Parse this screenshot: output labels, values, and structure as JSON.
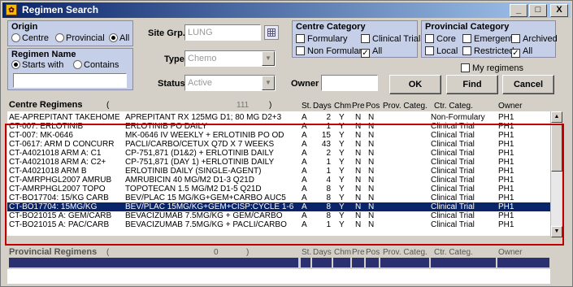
{
  "window": {
    "title": "Regimen Search",
    "app_icon": "app-icon",
    "minimize": "_",
    "maximize": "□",
    "close": "X"
  },
  "origin": {
    "title": "Origin",
    "options": [
      "Centre",
      "Provincial",
      "All"
    ],
    "selected": "All"
  },
  "regimen_name": {
    "title": "Regimen Name",
    "options": [
      "Starts with",
      "Contains"
    ],
    "selected": "Starts with",
    "value": ""
  },
  "site_group": {
    "label": "Site Grp.",
    "value": "LUNG"
  },
  "type": {
    "label": "Type",
    "value": "Chemo"
  },
  "status": {
    "label": "Status",
    "value": "Active"
  },
  "owner": {
    "label": "Owner",
    "value": ""
  },
  "centre_category": {
    "title": "Centre Category",
    "items": [
      {
        "label": "Formulary",
        "checked": false
      },
      {
        "label": "Clinical Trial",
        "checked": false
      },
      {
        "label": "Non Formulary",
        "checked": false
      },
      {
        "label": "All",
        "checked": true
      }
    ]
  },
  "provincial_category": {
    "title": "Provincial Category",
    "items": [
      {
        "label": "Core",
        "checked": false
      },
      {
        "label": "Emergent",
        "checked": false
      },
      {
        "label": "Archived",
        "checked": false
      },
      {
        "label": "Local",
        "checked": false
      },
      {
        "label": "Restricted",
        "checked": false
      },
      {
        "label": "All",
        "checked": true
      }
    ]
  },
  "my_regimens": {
    "label": "My regimens",
    "checked": false
  },
  "buttons": {
    "ok": "OK",
    "find": "Find",
    "cancel": "Cancel"
  },
  "centre_regimens": {
    "title": "Centre Regimens",
    "count_open": "(",
    "count": "111",
    "count_close": ")",
    "columns": [
      "St.",
      "Days",
      "Chm",
      "Pre",
      "Pos",
      "Prov. Categ.",
      "Ctr. Categ.",
      "Owner"
    ],
    "rows": [
      {
        "code": "AE-APREPITANT TAKEHOME",
        "desc": "APREPITANT RX 125MG D1; 80 MG D2+3",
        "st": "A",
        "days": "2",
        "chm": "Y",
        "pre": "N",
        "pos": "N",
        "prov": "",
        "ctr": "Non-Formulary",
        "owner": "PH1"
      },
      {
        "code": "CT-007: ERLOTINIB",
        "desc": "ERLOTINIB PO DAILY",
        "st": "A",
        "days": "1",
        "chm": "Y",
        "pre": "N",
        "pos": "N",
        "prov": "",
        "ctr": "Clinical Trial",
        "owner": "PH1"
      },
      {
        "code": "CT-007: MK-0646",
        "desc": "MK-0646 IV WEEKLY + ERLOTINIB PO OD",
        "st": "A",
        "days": "15",
        "chm": "Y",
        "pre": "N",
        "pos": "N",
        "prov": "",
        "ctr": "Clinical Trial",
        "owner": "PH1"
      },
      {
        "code": "CT-0617: ARM D CONCURR",
        "desc": "PACLI/CARBO/CETUX Q7D X 7 WEEKS",
        "st": "A",
        "days": "43",
        "chm": "Y",
        "pre": "N",
        "pos": "N",
        "prov": "",
        "ctr": "Clinical Trial",
        "owner": "PH1"
      },
      {
        "code": "CT-A4021018 ARM A: C1",
        "desc": "CP-751,871 (D1&2) + ERLOTINIB DAILY",
        "st": "A",
        "days": "2",
        "chm": "Y",
        "pre": "N",
        "pos": "N",
        "prov": "",
        "ctr": "Clinical Trial",
        "owner": "PH1"
      },
      {
        "code": "CT-A4021018 ARM A: C2+",
        "desc": "CP-751,871 (DAY 1) +ERLOTINIB DAILY",
        "st": "A",
        "days": "1",
        "chm": "Y",
        "pre": "N",
        "pos": "N",
        "prov": "",
        "ctr": "Clinical Trial",
        "owner": "PH1"
      },
      {
        "code": "CT-A4021018 ARM B",
        "desc": "ERLOTINIB DAILY (SINGLE-AGENT)",
        "st": "A",
        "days": "1",
        "chm": "Y",
        "pre": "N",
        "pos": "N",
        "prov": "",
        "ctr": "Clinical Trial",
        "owner": "PH1"
      },
      {
        "code": "CT-AMRPHGL2007 AMRUB",
        "desc": "AMRUBICIN 40 MG/M2 D1-3 Q21D",
        "st": "A",
        "days": "4",
        "chm": "Y",
        "pre": "N",
        "pos": "N",
        "prov": "",
        "ctr": "Clinical Trial",
        "owner": "PH1"
      },
      {
        "code": "CT-AMRPHGL2007 TOPO",
        "desc": "TOPOTECAN 1.5 MG/M2 D1-5 Q21D",
        "st": "A",
        "days": "8",
        "chm": "Y",
        "pre": "N",
        "pos": "N",
        "prov": "",
        "ctr": "Clinical Trial",
        "owner": "PH1"
      },
      {
        "code": "CT-BO17704: 15/KG CARB",
        "desc": "BEV/PLAC 15 MG/KG+GEM+CARBO AUC5",
        "st": "A",
        "days": "8",
        "chm": "Y",
        "pre": "N",
        "pos": "N",
        "prov": "",
        "ctr": "Clinical Trial",
        "owner": "PH1"
      },
      {
        "code": "CT-BO17704: 15MG/KG",
        "desc": "BEV/PLAC 15MG/KG+GEM+CISP:CYCLE 1-6",
        "st": "A",
        "days": "8",
        "chm": "Y",
        "pre": "N",
        "pos": "N",
        "prov": "",
        "ctr": "Clinical Trial",
        "owner": "PH1"
      },
      {
        "code": "CT-BO21015 A: GEM/CARB",
        "desc": "BEVACIZUMAB 7.5MG/KG + GEM/CARBO",
        "st": "A",
        "days": "8",
        "chm": "Y",
        "pre": "N",
        "pos": "N",
        "prov": "",
        "ctr": "Clinical Trial",
        "owner": "PH1"
      },
      {
        "code": "CT-BO21015 A: PAC/CARB",
        "desc": "BEVACIZUMAB 7.5MG/KG + PACLI/CARBO",
        "st": "A",
        "days": "1",
        "chm": "Y",
        "pre": "N",
        "pos": "N",
        "prov": "",
        "ctr": "Clinical Trial",
        "owner": "PH1"
      }
    ],
    "selected_index": 10
  },
  "provincial_regimens": {
    "title": "Provincial Regimens",
    "count_open": "(",
    "count": "0",
    "count_close": ")",
    "columns": [
      "St.",
      "Days",
      "Chm",
      "Pre",
      "Pos",
      "Prov. Categ.",
      "Ctr. Categ.",
      "Owner"
    ]
  },
  "colors": {
    "title_gradient_start": "#0a246a",
    "group_bg": "#c6cfe8",
    "selection": "#0a246a",
    "highlight_border": "#c00000"
  }
}
